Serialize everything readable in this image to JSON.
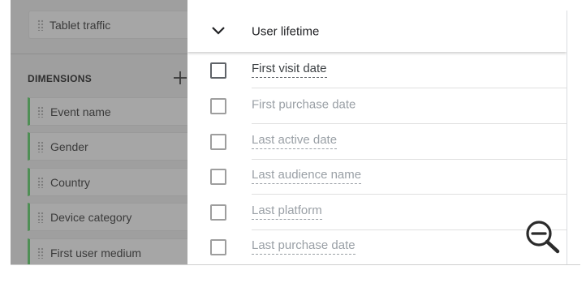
{
  "left_panel": {
    "top_chip_label": "Tablet traffic",
    "dimensions_heading": "DIMENSIONS",
    "add_icon": "plus-icon",
    "dimension_items": [
      {
        "label": "Event name"
      },
      {
        "label": "Gender"
      },
      {
        "label": "Country"
      },
      {
        "label": "Device category"
      },
      {
        "label": "First user medium"
      }
    ],
    "accent_color": "#4f8f55"
  },
  "picker": {
    "group_title": "User lifetime",
    "group_icon": "chevron-down-icon",
    "options": [
      {
        "label": "First visit date",
        "state": "enabled"
      },
      {
        "label": "First purchase date",
        "state": "disabled"
      },
      {
        "label": "Last active date",
        "state": "disabled"
      },
      {
        "label": "Last audience name",
        "state": "disabled"
      },
      {
        "label": "Last platform",
        "state": "disabled"
      },
      {
        "label": "Last purchase date",
        "state": "disabled"
      }
    ]
  },
  "overlay": {
    "zoom_icon": "zoom-out-icon"
  }
}
